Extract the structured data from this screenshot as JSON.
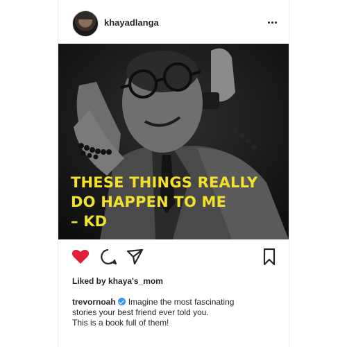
{
  "post": {
    "username": "khayadlanga",
    "overlay_lines": [
      "THESE THINGS REALLY",
      "DO HAPPEN TO ME",
      "– KD"
    ],
    "liked_by": "Liked by khaya's_mom",
    "comment_author": "trevornoah",
    "comment_line_1": "Imagine the most fascinating",
    "comment_line_2": "stories your best friend ever told you.",
    "comment_line_3": "This is a book full of them!"
  },
  "icons": {
    "more": "more-options-icon",
    "like": "heart-icon",
    "comment": "comment-icon",
    "share": "send-icon",
    "save": "bookmark-icon",
    "verified": "verified-badge-icon"
  },
  "colors": {
    "overlay_text": "#f2e12c",
    "heart": "#e0203a",
    "verified": "#3897f0",
    "text": "#262626"
  }
}
